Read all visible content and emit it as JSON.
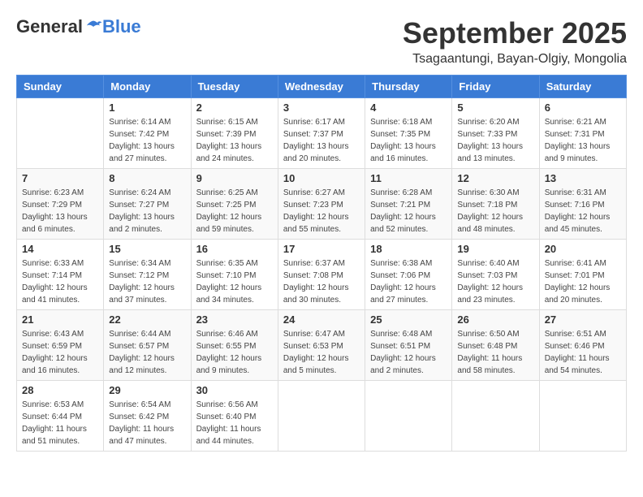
{
  "header": {
    "logo_general": "General",
    "logo_blue": "Blue",
    "month": "September 2025",
    "location": "Tsagaantungi, Bayan-Olgiy, Mongolia"
  },
  "weekdays": [
    "Sunday",
    "Monday",
    "Tuesday",
    "Wednesday",
    "Thursday",
    "Friday",
    "Saturday"
  ],
  "weeks": [
    [
      {
        "day": "",
        "info": ""
      },
      {
        "day": "1",
        "info": "Sunrise: 6:14 AM\nSunset: 7:42 PM\nDaylight: 13 hours\nand 27 minutes."
      },
      {
        "day": "2",
        "info": "Sunrise: 6:15 AM\nSunset: 7:39 PM\nDaylight: 13 hours\nand 24 minutes."
      },
      {
        "day": "3",
        "info": "Sunrise: 6:17 AM\nSunset: 7:37 PM\nDaylight: 13 hours\nand 20 minutes."
      },
      {
        "day": "4",
        "info": "Sunrise: 6:18 AM\nSunset: 7:35 PM\nDaylight: 13 hours\nand 16 minutes."
      },
      {
        "day": "5",
        "info": "Sunrise: 6:20 AM\nSunset: 7:33 PM\nDaylight: 13 hours\nand 13 minutes."
      },
      {
        "day": "6",
        "info": "Sunrise: 6:21 AM\nSunset: 7:31 PM\nDaylight: 13 hours\nand 9 minutes."
      }
    ],
    [
      {
        "day": "7",
        "info": "Sunrise: 6:23 AM\nSunset: 7:29 PM\nDaylight: 13 hours\nand 6 minutes."
      },
      {
        "day": "8",
        "info": "Sunrise: 6:24 AM\nSunset: 7:27 PM\nDaylight: 13 hours\nand 2 minutes."
      },
      {
        "day": "9",
        "info": "Sunrise: 6:25 AM\nSunset: 7:25 PM\nDaylight: 12 hours\nand 59 minutes."
      },
      {
        "day": "10",
        "info": "Sunrise: 6:27 AM\nSunset: 7:23 PM\nDaylight: 12 hours\nand 55 minutes."
      },
      {
        "day": "11",
        "info": "Sunrise: 6:28 AM\nSunset: 7:21 PM\nDaylight: 12 hours\nand 52 minutes."
      },
      {
        "day": "12",
        "info": "Sunrise: 6:30 AM\nSunset: 7:18 PM\nDaylight: 12 hours\nand 48 minutes."
      },
      {
        "day": "13",
        "info": "Sunrise: 6:31 AM\nSunset: 7:16 PM\nDaylight: 12 hours\nand 45 minutes."
      }
    ],
    [
      {
        "day": "14",
        "info": "Sunrise: 6:33 AM\nSunset: 7:14 PM\nDaylight: 12 hours\nand 41 minutes."
      },
      {
        "day": "15",
        "info": "Sunrise: 6:34 AM\nSunset: 7:12 PM\nDaylight: 12 hours\nand 37 minutes."
      },
      {
        "day": "16",
        "info": "Sunrise: 6:35 AM\nSunset: 7:10 PM\nDaylight: 12 hours\nand 34 minutes."
      },
      {
        "day": "17",
        "info": "Sunrise: 6:37 AM\nSunset: 7:08 PM\nDaylight: 12 hours\nand 30 minutes."
      },
      {
        "day": "18",
        "info": "Sunrise: 6:38 AM\nSunset: 7:06 PM\nDaylight: 12 hours\nand 27 minutes."
      },
      {
        "day": "19",
        "info": "Sunrise: 6:40 AM\nSunset: 7:03 PM\nDaylight: 12 hours\nand 23 minutes."
      },
      {
        "day": "20",
        "info": "Sunrise: 6:41 AM\nSunset: 7:01 PM\nDaylight: 12 hours\nand 20 minutes."
      }
    ],
    [
      {
        "day": "21",
        "info": "Sunrise: 6:43 AM\nSunset: 6:59 PM\nDaylight: 12 hours\nand 16 minutes."
      },
      {
        "day": "22",
        "info": "Sunrise: 6:44 AM\nSunset: 6:57 PM\nDaylight: 12 hours\nand 12 minutes."
      },
      {
        "day": "23",
        "info": "Sunrise: 6:46 AM\nSunset: 6:55 PM\nDaylight: 12 hours\nand 9 minutes."
      },
      {
        "day": "24",
        "info": "Sunrise: 6:47 AM\nSunset: 6:53 PM\nDaylight: 12 hours\nand 5 minutes."
      },
      {
        "day": "25",
        "info": "Sunrise: 6:48 AM\nSunset: 6:51 PM\nDaylight: 12 hours\nand 2 minutes."
      },
      {
        "day": "26",
        "info": "Sunrise: 6:50 AM\nSunset: 6:48 PM\nDaylight: 11 hours\nand 58 minutes."
      },
      {
        "day": "27",
        "info": "Sunrise: 6:51 AM\nSunset: 6:46 PM\nDaylight: 11 hours\nand 54 minutes."
      }
    ],
    [
      {
        "day": "28",
        "info": "Sunrise: 6:53 AM\nSunset: 6:44 PM\nDaylight: 11 hours\nand 51 minutes."
      },
      {
        "day": "29",
        "info": "Sunrise: 6:54 AM\nSunset: 6:42 PM\nDaylight: 11 hours\nand 47 minutes."
      },
      {
        "day": "30",
        "info": "Sunrise: 6:56 AM\nSunset: 6:40 PM\nDaylight: 11 hours\nand 44 minutes."
      },
      {
        "day": "",
        "info": ""
      },
      {
        "day": "",
        "info": ""
      },
      {
        "day": "",
        "info": ""
      },
      {
        "day": "",
        "info": ""
      }
    ]
  ]
}
